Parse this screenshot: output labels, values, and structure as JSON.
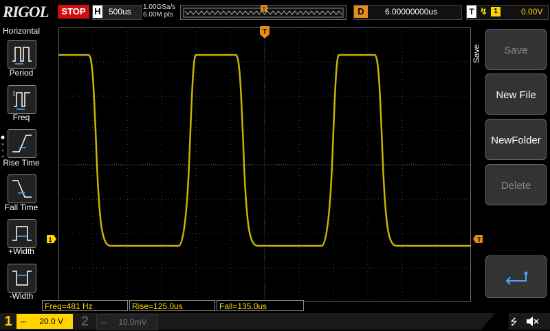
{
  "header": {
    "logo": "RIGOL",
    "run_state": "STOP",
    "horizontal_label": "H",
    "timebase": "500us",
    "sample_rate": "1.00GSa/s",
    "memory_depth": "6.00M pts",
    "trigger_marker": "T",
    "delay_label": "D",
    "delay_value": "6.00000000us",
    "trigger_label": "T",
    "trigger_channel": "1",
    "trigger_level": "0.00V"
  },
  "left_panel": {
    "title": "Horizontal",
    "items": [
      {
        "label": "Period",
        "icon": "period-icon"
      },
      {
        "label": "Freq",
        "icon": "freq-icon"
      },
      {
        "label": "Rise Time",
        "icon": "rise-time-icon"
      },
      {
        "label": "Fall Time",
        "icon": "fall-time-icon"
      },
      {
        "label": "+Width",
        "icon": "positive-width-icon"
      },
      {
        "label": "-Width",
        "icon": "negative-width-icon"
      }
    ]
  },
  "right_panel": {
    "title": "Save",
    "buttons": [
      {
        "label": "Save",
        "enabled": false
      },
      {
        "label": "New File",
        "enabled": true
      },
      {
        "label": "NewFolder",
        "enabled": true
      },
      {
        "label": "Delete",
        "enabled": false
      },
      {
        "label": "",
        "icon": "enter-icon",
        "enabled": true
      }
    ]
  },
  "waveform": {
    "trigger_marker_top": "T",
    "channel_marker": "1",
    "trigger_level_marker": "T",
    "color": "#ffd400"
  },
  "measurements": {
    "freq": "Freq=481 Hz",
    "rise": "Rise=125.0us",
    "fall": "Fall=135.0us"
  },
  "footer": {
    "ch1_number": "1",
    "ch1_coupling_icon": "dc-coupling-icon",
    "ch1_scale": "20.0 V",
    "ch2_number": "2",
    "ch2_coupling_icon": "dc-coupling-icon",
    "ch2_scale": "10.0mV",
    "usb_icon": "usb-icon",
    "mute_icon": "speaker-mute-icon"
  },
  "colors": {
    "ch1": "#ffd400",
    "stop": "#d01010",
    "delay": "#e88a1a"
  }
}
